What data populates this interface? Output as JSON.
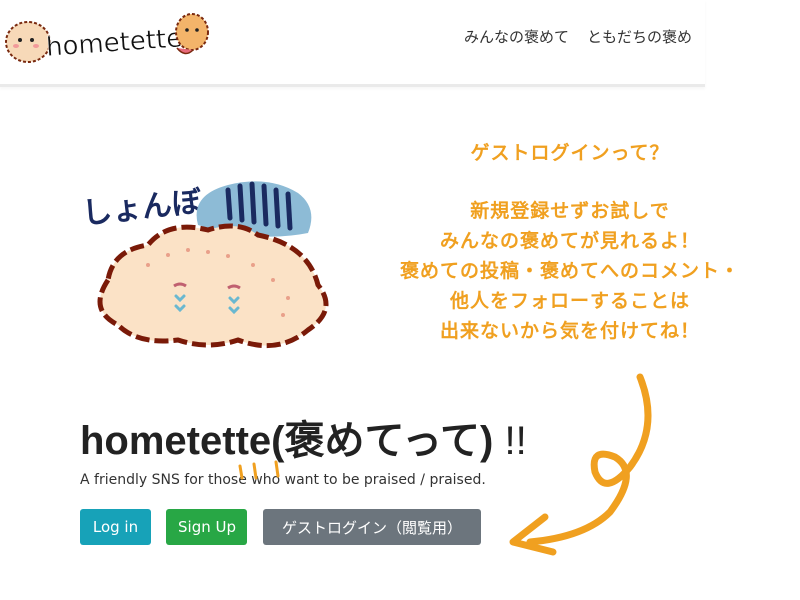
{
  "navbar": {
    "logo_text": "hometette!",
    "links": [
      "みんなの褒めて",
      "ともだちの褒め"
    ]
  },
  "hero": {
    "sigh_text": "しょんぼ…",
    "guest_note": {
      "question": "ゲストログインって？",
      "lines": [
        "新規登録せずお試しで",
        "みんなの褒めてが見れるよ！",
        "褒めての投稿・褒めてへのコメント・",
        "他人をフォローすることは",
        "出来ないから気を付けてね！"
      ]
    },
    "title": "hometette(褒めてって)",
    "title_suffix": " !!",
    "subtitle": "A friendly SNS for those who want to be praised / praised.",
    "buttons": {
      "login": "Log in",
      "signup": "Sign Up",
      "guest": "ゲストログイン（閲覧用）"
    }
  },
  "colors": {
    "accent_orange": "#f0a020",
    "login": "#17a2b8",
    "signup": "#28a745",
    "guest": "#6c757d"
  }
}
